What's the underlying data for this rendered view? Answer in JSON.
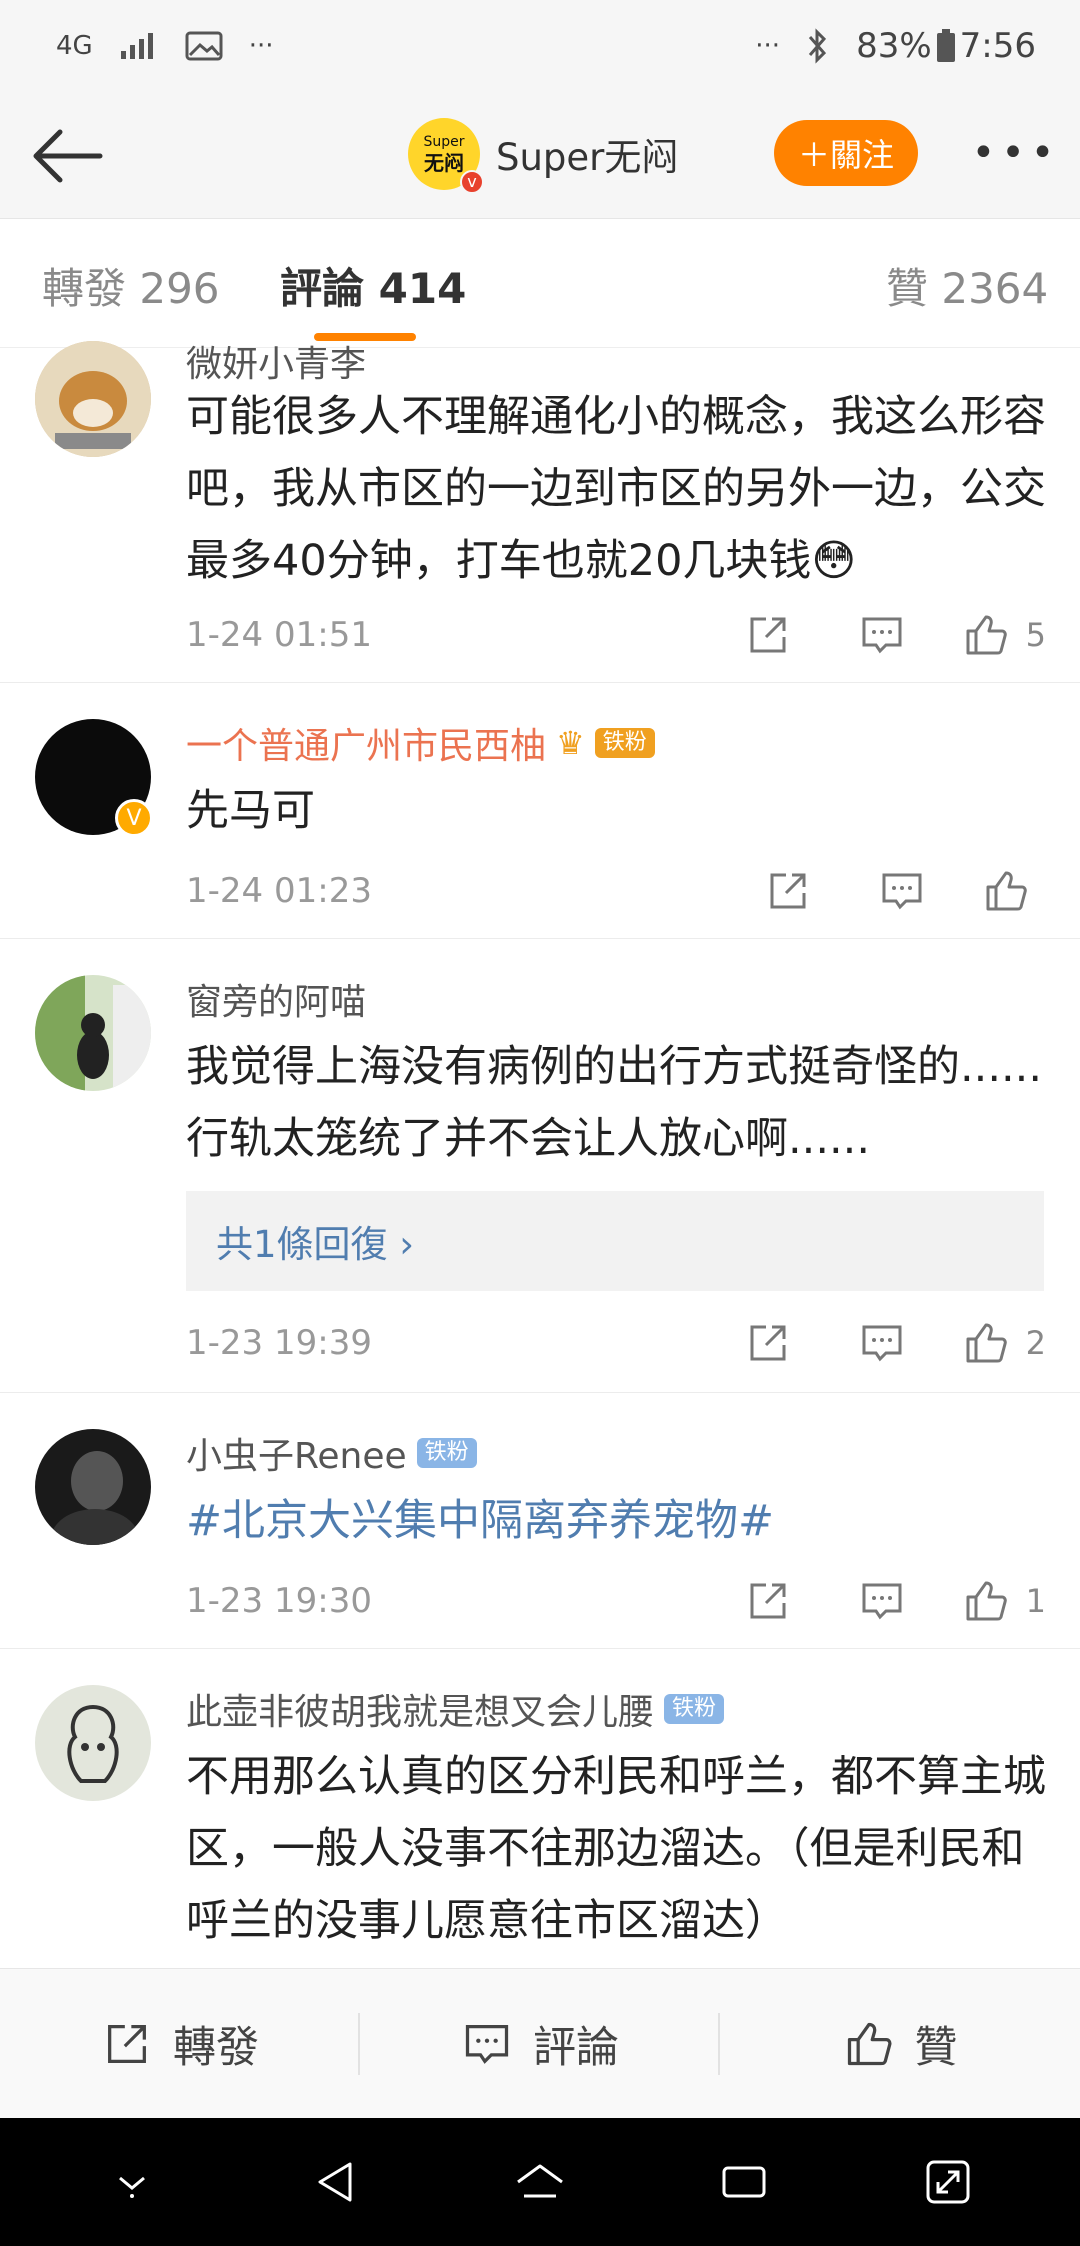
{
  "status_bar": {
    "network": "4G",
    "battery": "83%",
    "time": "7:56"
  },
  "header": {
    "title": "Super无闷",
    "follow_label": "＋關注",
    "avatar_top": "Super",
    "avatar_bottom": "无闷"
  },
  "tabs": {
    "repost": "轉發 296",
    "comments": "評論 414",
    "likes": "贊 2364"
  },
  "comments": [
    {
      "username": "微妍小青李",
      "text": "可能很多人不理解通化小的概念，我这么形容吧，我从市区的一边到市区的另外一边，公交最多40分钟，打车也就20几块钱😳",
      "time": "1-24 01:51",
      "like_count": "5"
    },
    {
      "username": "一个普通广州市民西柚",
      "badge": "铁粉",
      "text": "先马可",
      "time": "1-24 01:23",
      "like_count": ""
    },
    {
      "username": "窗旁的阿喵",
      "text": "我觉得上海没有病例的出行方式挺奇怪的......行轨太笼统了并不会让人放心啊......",
      "reply_summary": "共1條回復 ›",
      "time": "1-23 19:39",
      "like_count": "2"
    },
    {
      "username": "小虫子Renee",
      "badge": "铁粉",
      "text": "#北京大兴集中隔离弃养宠物#",
      "time": "1-23 19:30",
      "like_count": "1"
    },
    {
      "username": "此壶非彼胡我就是想叉会儿腰",
      "badge": "铁粉",
      "text": "不用那么认真的区分利民和呼兰，都不算主城区，一般人没事不往那边溜达。（但是利民和呼兰的没事儿愿意往市区溜达）"
    }
  ],
  "bottom_bar": {
    "repost": "轉發",
    "comment": "評論",
    "like": "贊"
  },
  "colors": {
    "accent": "#ff8200",
    "link": "#507daf",
    "orange_name": "#eb7350"
  }
}
